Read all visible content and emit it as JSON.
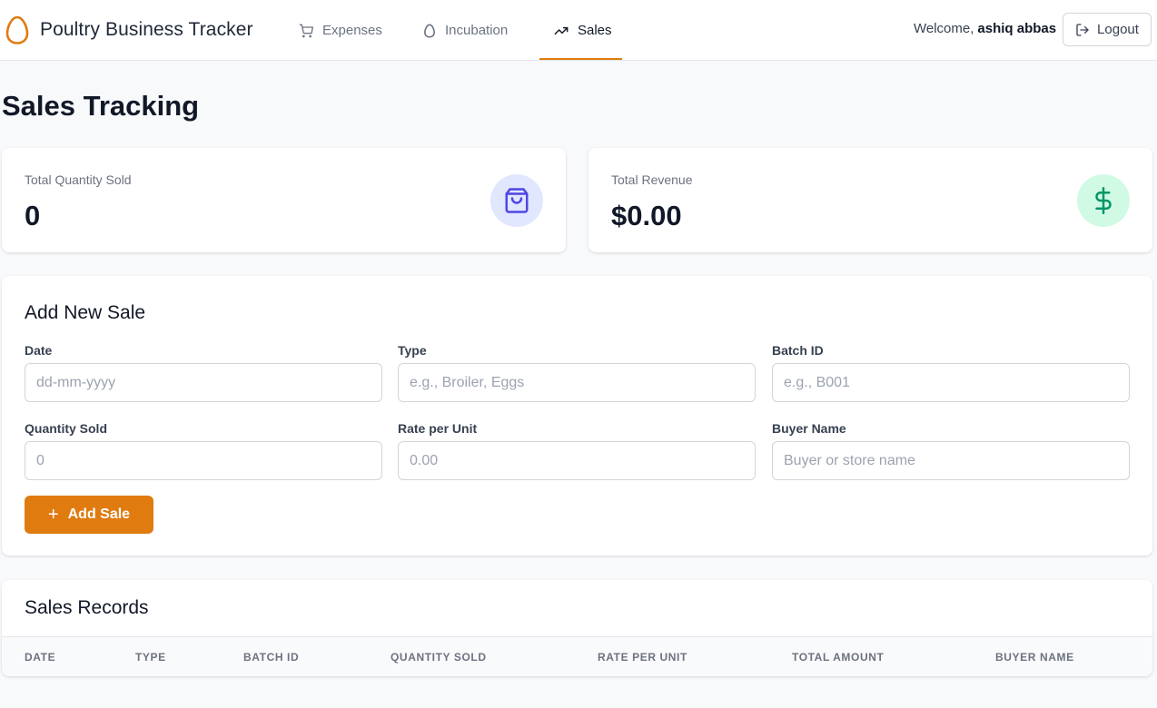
{
  "app": {
    "title": "Poultry Business Tracker",
    "accent_color": "#e07b10",
    "logo_icon": "egg-icon"
  },
  "nav": {
    "tabs": [
      {
        "label": "Expenses",
        "icon": "cart-icon",
        "active": false
      },
      {
        "label": "Incubation",
        "icon": "egg-icon",
        "active": false
      },
      {
        "label": "Sales",
        "icon": "trending-up-icon",
        "active": true
      }
    ]
  },
  "user": {
    "welcome_prefix": "Welcome,",
    "name": "ashiq abbas",
    "logout_label": "Logout"
  },
  "page": {
    "title": "Sales Tracking"
  },
  "stats": {
    "quantity": {
      "label": "Total Quantity Sold",
      "value": "0",
      "icon": "shopping-bag-icon",
      "icon_color": "#4f46e5",
      "icon_bg": "#e0e7ff"
    },
    "revenue": {
      "label": "Total Revenue",
      "value": "$0.00",
      "icon": "dollar-icon",
      "icon_color": "#059669",
      "icon_bg": "#d1fae5"
    }
  },
  "form": {
    "title": "Add New Sale",
    "date": {
      "label": "Date",
      "placeholder": "dd-mm-yyyy"
    },
    "type": {
      "label": "Type",
      "placeholder": "e.g., Broiler, Eggs"
    },
    "batch": {
      "label": "Batch ID",
      "placeholder": "e.g., B001"
    },
    "quantity": {
      "label": "Quantity Sold",
      "placeholder": "0"
    },
    "rate": {
      "label": "Rate per Unit",
      "placeholder": "0.00"
    },
    "buyer": {
      "label": "Buyer Name",
      "placeholder": "Buyer or store name"
    },
    "submit_icon": "+",
    "submit_label": "Add Sale"
  },
  "records": {
    "title": "Sales Records",
    "columns": [
      "Date",
      "Type",
      "Batch ID",
      "Quantity Sold",
      "Rate per Unit",
      "Total Amount",
      "Buyer Name"
    ],
    "rows": []
  }
}
